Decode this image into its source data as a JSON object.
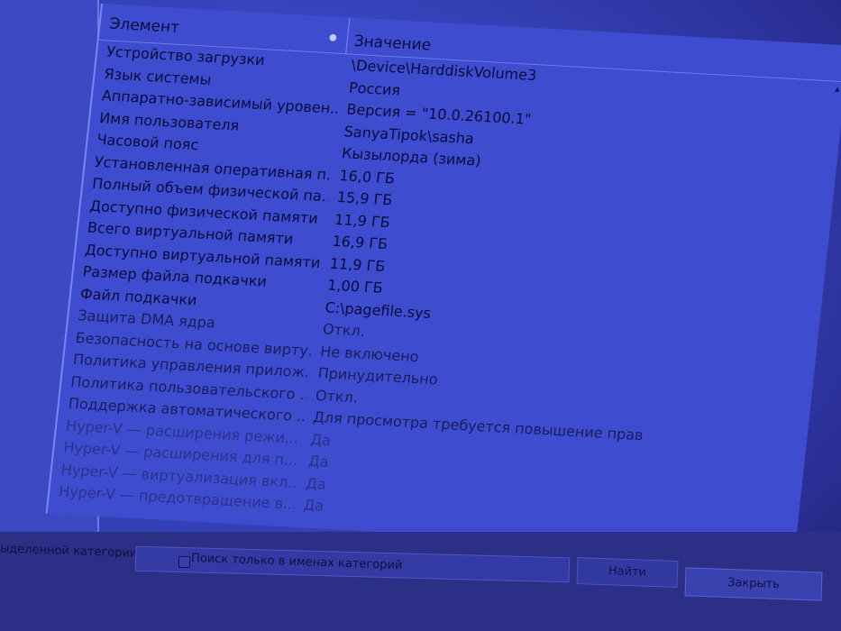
{
  "list": {
    "col_element": "Элемент",
    "col_value": "Значение",
    "rows": [
      {
        "element": "Устройство загрузки",
        "value": "\\Device\\HarddiskVolume3"
      },
      {
        "element": "Язык системы",
        "value": "Россия"
      },
      {
        "element": "Аппаратно-зависимый уровен...",
        "value": "Версия = \"10.0.26100.1\""
      },
      {
        "element": "Имя пользователя",
        "value": "SanyaTipok\\sasha"
      },
      {
        "element": "Часовой пояс",
        "value": "Кызылорда (зима)"
      },
      {
        "element": "Установленная оперативная п...",
        "value": "16,0 ГБ"
      },
      {
        "element": "Полный объем физической па...",
        "value": "15,9 ГБ"
      },
      {
        "element": "Доступно физической памяти",
        "value": "11,9 ГБ"
      },
      {
        "element": "Всего виртуальной памяти",
        "value": "16,9 ГБ"
      },
      {
        "element": "Доступно виртуальной памяти",
        "value": "11,9 ГБ"
      },
      {
        "element": "Размер файла подкачки",
        "value": "1,00 ГБ"
      },
      {
        "element": "Файл подкачки",
        "value": "C:\\pagefile.sys"
      },
      {
        "element": "Защита DMA ядра",
        "value": "Откл."
      },
      {
        "element": "Безопасность на основе вирту...",
        "value": "Не включено"
      },
      {
        "element": "Политика управления прилож...",
        "value": "Принудительно"
      },
      {
        "element": "Политика пользовательского ...",
        "value": "Откл."
      },
      {
        "element": "Поддержка автоматического ...",
        "value": "Для просмотра требуется повышение прав"
      },
      {
        "element": "Hyper-V — расширения режи...",
        "value": "Да"
      },
      {
        "element": "Hyper-V — расширения для п...",
        "value": "Да"
      },
      {
        "element": "Hyper-V — виртуализация вкл...",
        "value": "Да"
      },
      {
        "element": "Hyper-V — предотвращение в...",
        "value": "Да"
      }
    ]
  },
  "search": {
    "left_label": "ыделенной категории",
    "checkbox_label": "Поиск только в именах категорий",
    "find_label": "Найти",
    "close_label": "Закрыть"
  }
}
